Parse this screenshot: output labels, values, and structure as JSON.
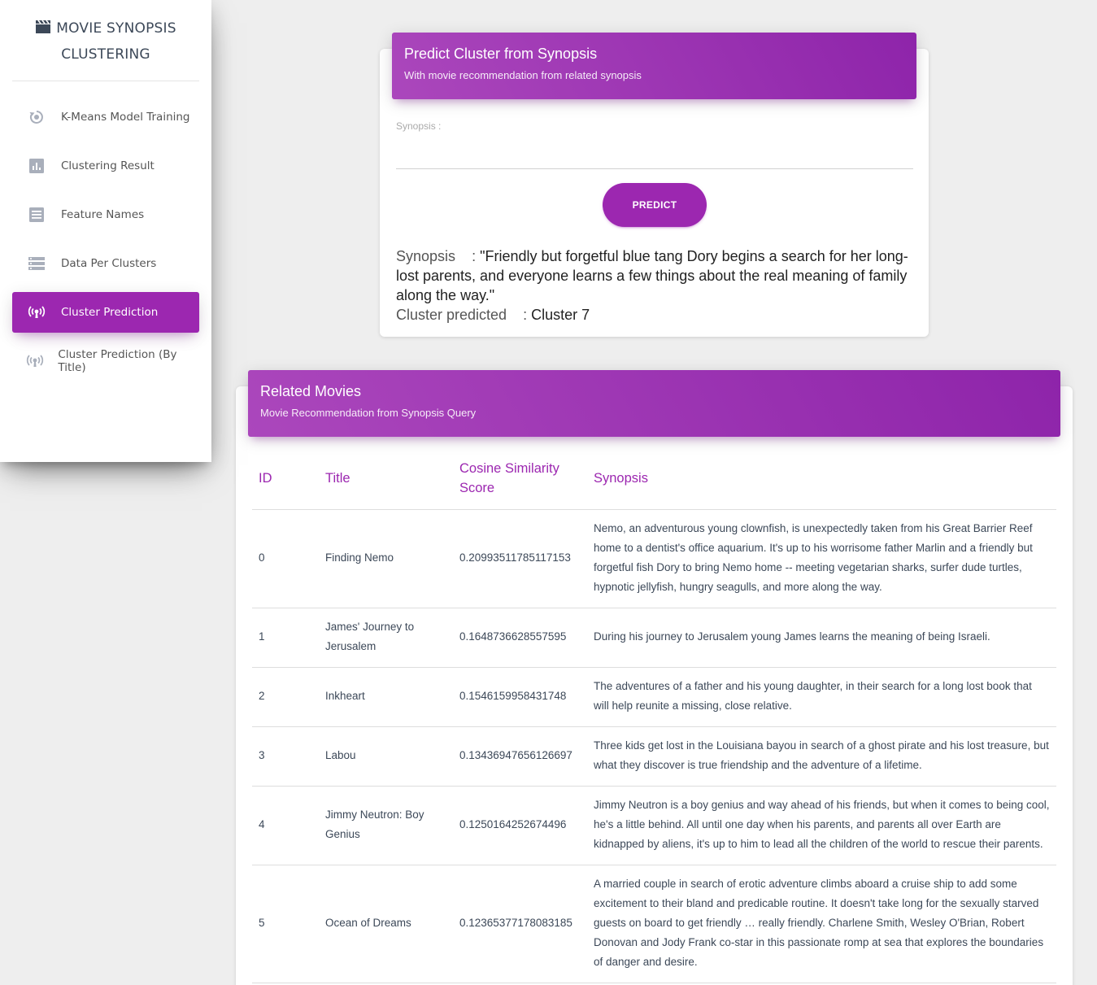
{
  "sidebar": {
    "brand_line1": "MOVIE SYNOPSIS",
    "brand_line2": "CLUSTERING",
    "brand_icon": "clapperboard-icon",
    "items": [
      {
        "label": "K-Means Model Training",
        "icon": "rotate-icon"
      },
      {
        "label": "Clustering Result",
        "icon": "bar-chart-icon"
      },
      {
        "label": "Feature Names",
        "icon": "list-icon"
      },
      {
        "label": "Data Per Clusters",
        "icon": "storage-icon"
      },
      {
        "label": "Cluster Prediction",
        "icon": "broadcast-icon",
        "active": true
      },
      {
        "label": "Cluster Prediction (By Title)",
        "icon": "broadcast-icon"
      }
    ]
  },
  "predict": {
    "title": "Predict Cluster from Synopsis",
    "subtitle": "With movie recommendation from related synopsis",
    "input_label": "Synopsis :",
    "input_value": "",
    "button_label": "PREDICT",
    "result_synopsis_label": "Synopsis",
    "result_synopsis_sep": ":",
    "result_synopsis_value": "\"Friendly but forgetful blue tang Dory begins a search for her long-lost parents, and everyone learns a few things about the real meaning of family along the way.\"",
    "result_cluster_label": "Cluster predicted",
    "result_cluster_sep": ":",
    "result_cluster_value": "Cluster 7"
  },
  "related": {
    "title": "Related Movies",
    "subtitle": "Movie Recommendation from Synopsis Query",
    "columns": [
      "ID",
      "Title",
      "Cosine Similarity Score",
      "Synopsis"
    ],
    "rows": [
      {
        "id": "0",
        "title": "Finding Nemo",
        "score": "0.20993511785117153",
        "synopsis": "Nemo, an adventurous young clownfish, is unexpectedly taken from his Great Barrier Reef home to a dentist's office aquarium. It's up to his worrisome father Marlin and a friendly but forgetful fish Dory to bring Nemo home -- meeting vegetarian sharks, surfer dude turtles, hypnotic jellyfish, hungry seagulls, and more along the way."
      },
      {
        "id": "1",
        "title": "James' Journey to Jerusalem",
        "score": "0.1648736628557595",
        "synopsis": "During his journey to Jerusalem young James learns the meaning of being Israeli."
      },
      {
        "id": "2",
        "title": "Inkheart",
        "score": "0.1546159958431748",
        "synopsis": "The adventures of a father and his young daughter, in their search for a long lost book that will help reunite a missing, close relative."
      },
      {
        "id": "3",
        "title": "Labou",
        "score": "0.13436947656126697",
        "synopsis": "Three kids get lost in the Louisiana bayou in search of a ghost pirate and his lost treasure, but what they discover is true friendship and the adventure of a lifetime."
      },
      {
        "id": "4",
        "title": "Jimmy Neutron: Boy Genius",
        "score": "0.1250164252674496",
        "synopsis": "Jimmy Neutron is a boy genius and way ahead of his friends, but when it comes to being cool, he's a little behind. All until one day when his parents, and parents all over Earth are kidnapped by aliens, it's up to him to lead all the children of the world to rescue their parents."
      },
      {
        "id": "5",
        "title": "Ocean of Dreams",
        "score": "0.12365377178083185",
        "synopsis": "A married couple in search of erotic adventure climbs aboard a cruise ship to add some excitement to their bland and predicable routine. It doesn't take long for the sexually starved guests on board to get friendly … really friendly. Charlene Smith, Wesley O'Brian, Robert Donovan and Jody Frank co-star in this passionate romp at sea that explores the boundaries of danger and desire."
      }
    ]
  },
  "colors": {
    "accent": "#9c27b0",
    "background": "#eeeeee",
    "icon_grey": "#a9afbb"
  }
}
